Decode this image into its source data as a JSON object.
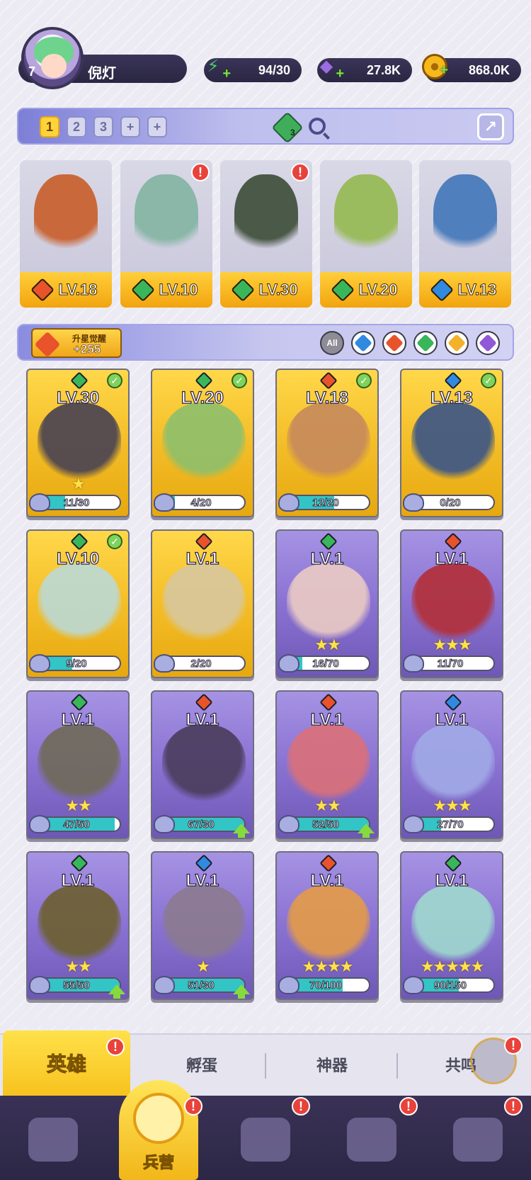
{
  "player": {
    "level": "7",
    "name": "倪灯"
  },
  "resources": [
    {
      "name": "energy",
      "icon": "lightning-icon",
      "value": "94/30",
      "color": "#48d06a"
    },
    {
      "name": "gems",
      "icon": "diamond-icon",
      "value": "27.8K",
      "color": "#9b6de2"
    },
    {
      "name": "coins",
      "icon": "coin-icon",
      "value": "868.0K",
      "color": "#f5b91d"
    }
  ],
  "team_bar": {
    "tabs": [
      "1",
      "2",
      "3",
      "+",
      "+"
    ],
    "active_tab": "1",
    "gem_count": "3"
  },
  "team_slots": [
    {
      "level": "LV.18",
      "element": "fire",
      "color": "#e8532b",
      "art": "#c9693b",
      "alert": false
    },
    {
      "level": "LV.10",
      "element": "wind",
      "color": "#39b65a",
      "art": "#8ab7a8",
      "alert": true
    },
    {
      "level": "LV.30",
      "element": "wind",
      "color": "#39b65a",
      "art": "#4b5a48",
      "alert": true
    },
    {
      "level": "LV.20",
      "element": "wind",
      "color": "#39b65a",
      "art": "#9bbb5f",
      "alert": false
    },
    {
      "level": "LV.13",
      "element": "water",
      "color": "#2f8ae0",
      "art": "#4f7fbd",
      "alert": false
    }
  ],
  "filter_bar": {
    "star_label": "升星觉醒",
    "star_count": "+255",
    "filters": [
      {
        "name": "All",
        "color": "#8e8c96"
      },
      {
        "name": "water",
        "color": "#2f8ae0"
      },
      {
        "name": "fire",
        "color": "#e8532b"
      },
      {
        "name": "wind",
        "color": "#39b65a"
      },
      {
        "name": "light",
        "color": "#f3b22b"
      },
      {
        "name": "dark",
        "color": "#9257d6"
      }
    ]
  },
  "heroes": [
    {
      "level": "LV.30",
      "progress": "11/30",
      "frac": 0.37,
      "rarity": "gold",
      "element_color": "#39b65a",
      "check": true,
      "stars": "★",
      "art": "#4a4352",
      "up": false
    },
    {
      "level": "LV.20",
      "progress": "4/20",
      "frac": 0.2,
      "rarity": "gold",
      "element_color": "#39b65a",
      "check": true,
      "stars": "",
      "art": "#8fbf6a",
      "up": false
    },
    {
      "level": "LV.18",
      "progress": "12/20",
      "frac": 0.6,
      "rarity": "gold",
      "element_color": "#e8532b",
      "check": true,
      "stars": "",
      "art": "#c78a5b",
      "up": false
    },
    {
      "level": "LV.13",
      "progress": "0/20",
      "frac": 0.0,
      "rarity": "gold",
      "element_color": "#2f8ae0",
      "check": true,
      "stars": "",
      "art": "#3d5685",
      "up": false
    },
    {
      "level": "LV.10",
      "progress": "9/20",
      "frac": 0.45,
      "rarity": "gold",
      "element_color": "#39b65a",
      "check": true,
      "stars": "",
      "art": "#bcd9d3",
      "up": false
    },
    {
      "level": "LV.1",
      "progress": "2/20",
      "frac": 0.1,
      "rarity": "gold",
      "element_color": "#e8532b",
      "check": false,
      "stars": "",
      "art": "#d8c79b",
      "up": false
    },
    {
      "level": "LV.1",
      "progress": "16/70",
      "frac": 0.23,
      "rarity": "purple",
      "element_color": "#39b65a",
      "check": false,
      "stars": "★★",
      "art": "#e9c9c4",
      "up": false
    },
    {
      "level": "LV.1",
      "progress": "11/70",
      "frac": 0.16,
      "rarity": "purple",
      "element_color": "#e8532b",
      "check": false,
      "stars": "★★★",
      "art": "#b2303a",
      "up": false
    },
    {
      "level": "LV.1",
      "progress": "47/50",
      "frac": 0.94,
      "rarity": "purple",
      "element_color": "#39b65a",
      "check": false,
      "stars": "★★",
      "art": "#6f6a5a",
      "up": false
    },
    {
      "level": "LV.1",
      "progress": "67/30",
      "frac": 1.0,
      "rarity": "purple",
      "element_color": "#e8532b",
      "check": false,
      "stars": "",
      "art": "#4b3d5e",
      "up": true
    },
    {
      "level": "LV.1",
      "progress": "52/50",
      "frac": 1.0,
      "rarity": "purple",
      "element_color": "#e8532b",
      "check": false,
      "stars": "★★",
      "art": "#d9707a",
      "up": true
    },
    {
      "level": "LV.1",
      "progress": "27/70",
      "frac": 0.39,
      "rarity": "purple",
      "element_color": "#2f8ae0",
      "check": false,
      "stars": "★★★",
      "art": "#a0a9e6",
      "up": false
    },
    {
      "level": "LV.1",
      "progress": "55/50",
      "frac": 1.0,
      "rarity": "purple",
      "element_color": "#39b65a",
      "check": false,
      "stars": "★★",
      "art": "#6d6032",
      "up": true
    },
    {
      "level": "LV.1",
      "progress": "51/30",
      "frac": 1.0,
      "rarity": "purple",
      "element_color": "#2f8ae0",
      "check": false,
      "stars": "★",
      "art": "#8b7a90",
      "up": true
    },
    {
      "level": "LV.1",
      "progress": "70/100",
      "frac": 0.7,
      "rarity": "purple",
      "element_color": "#e8532b",
      "check": false,
      "stars": "★★★★",
      "art": "#e39a4a",
      "up": false
    },
    {
      "level": "LV.1",
      "progress": "90/150",
      "frac": 0.6,
      "rarity": "purple",
      "element_color": "#39b65a",
      "check": false,
      "stars": "★★★★★",
      "art": "#9fd7cf",
      "up": false
    }
  ],
  "sub_tabs": [
    {
      "label": "英雄",
      "active": true,
      "alert": true
    },
    {
      "label": "孵蛋",
      "active": false,
      "alert": false
    },
    {
      "label": "神器",
      "active": false,
      "alert": false
    },
    {
      "label": "共鸣",
      "active": false,
      "alert": true
    }
  ],
  "bottom_nav": [
    {
      "label": "",
      "icon": "cards-icon",
      "active": false,
      "alert": false
    },
    {
      "label": "兵营",
      "icon": "barracks-icon",
      "active": true,
      "alert": true
    },
    {
      "label": "",
      "icon": "map-icon",
      "active": false,
      "alert": true
    },
    {
      "label": "",
      "icon": "guild-hall-icon",
      "active": false,
      "alert": true
    },
    {
      "label": "",
      "icon": "shop-icon",
      "active": false,
      "alert": true
    }
  ]
}
